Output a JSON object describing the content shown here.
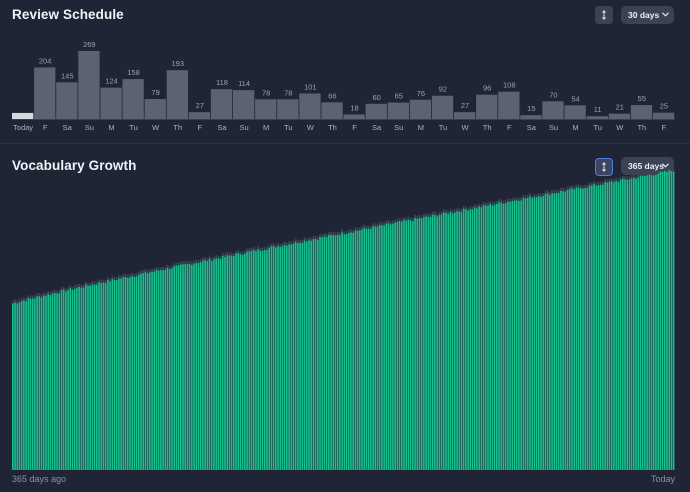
{
  "review": {
    "title": "Review Schedule",
    "range_label": "30 days",
    "sort_icon": "sort-icon",
    "chevron_icon": "chevron-down-icon"
  },
  "growth": {
    "title": "Vocabulary Growth",
    "range_label": "365 days",
    "sort_icon": "sort-icon",
    "chevron_icon": "chevron-down-icon",
    "start_label": "365 days ago",
    "end_label": "Today"
  },
  "colors": {
    "background": "#1f2535",
    "review_bar": "#5b6373",
    "review_today_bar": "#d5d8de",
    "growth_bar": "#17c08f",
    "growth_gap": "#3e4554"
  },
  "chart_data": [
    {
      "type": "bar",
      "title": "Review Schedule",
      "categories": [
        "Today",
        "F",
        "Sa",
        "Su",
        "M",
        "Tu",
        "W",
        "Th",
        "F",
        "Sa",
        "Su",
        "M",
        "Tu",
        "W",
        "Th",
        "F",
        "Sa",
        "Su",
        "M",
        "Tu",
        "W",
        "Th",
        "F",
        "Sa",
        "Su",
        "M",
        "Tu",
        "W",
        "Th",
        "F"
      ],
      "values": [
        24,
        204,
        145,
        269,
        124,
        158,
        79,
        193,
        27,
        118,
        114,
        78,
        78,
        101,
        66,
        18,
        60,
        65,
        76,
        92,
        27,
        96,
        108,
        15,
        70,
        54,
        11,
        21,
        55,
        25
      ],
      "ylim": [
        0,
        269
      ],
      "grid": false,
      "highlight_index": 0
    },
    {
      "type": "bar",
      "title": "Vocabulary Growth",
      "x_range_days": 365,
      "ylim": [
        0,
        1000
      ],
      "start_value": 555,
      "end_value": 998,
      "grid": false,
      "x_labels": [
        "365 days ago",
        "Today"
      ]
    }
  ]
}
